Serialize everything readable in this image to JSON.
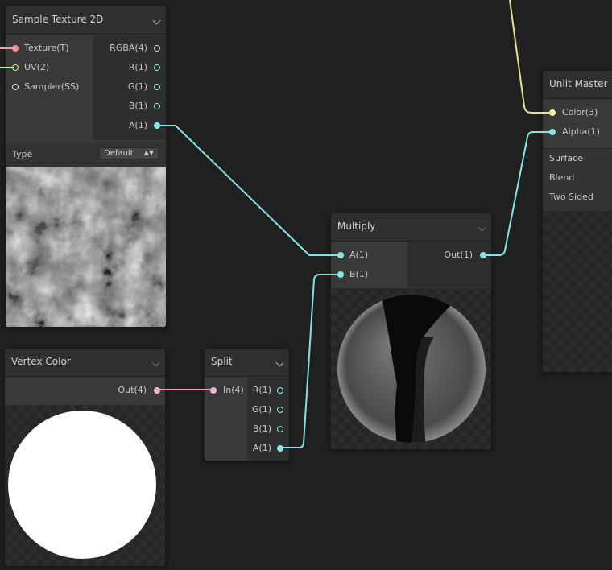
{
  "colors": {
    "background": "#202020",
    "wire_vector1": "#84e4e7",
    "wire_color": "#e2e48e",
    "wire_texture": "#f4a0b4",
    "port_vector1": "#84e4e7",
    "port_vector3": "#f5f3a3",
    "port_vector4": "#f2b8d6",
    "port_texture": "#ff8e8e",
    "port_vector2": "#b6f6a2",
    "port_sampler": "#e6e6e6"
  },
  "nodes": {
    "sample_texture": {
      "title": "Sample Texture 2D",
      "inputs": [
        "Texture(T)",
        "UV(2)",
        "Sampler(SS)"
      ],
      "outputs": [
        "RGBA(4)",
        "R(1)",
        "G(1)",
        "B(1)",
        "A(1)"
      ],
      "type_label": "Type",
      "type_value": "Default"
    },
    "vertex_color": {
      "title": "Vertex Color",
      "outputs": [
        "Out(4)"
      ]
    },
    "split": {
      "title": "Split",
      "inputs": [
        "In(4)"
      ],
      "outputs": [
        "R(1)",
        "G(1)",
        "B(1)",
        "A(1)"
      ]
    },
    "multiply": {
      "title": "Multiply",
      "inputs": [
        "A(1)",
        "B(1)"
      ],
      "outputs": [
        "Out(1)"
      ]
    },
    "unlit_master": {
      "title": "Unlit Master",
      "inputs": [
        "Color(3)",
        "Alpha(1)"
      ],
      "settings": [
        "Surface",
        "Blend",
        "Two Sided"
      ]
    }
  }
}
